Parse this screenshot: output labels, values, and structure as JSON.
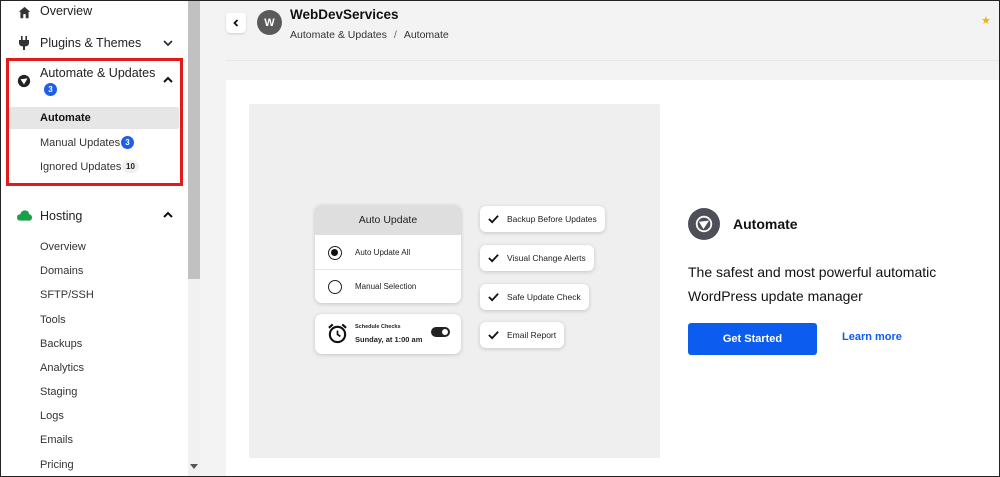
{
  "sidebar": {
    "overview": "Overview",
    "plugins_themes": "Plugins & Themes",
    "automate_updates": "Automate & Updates",
    "automate_badge": "3",
    "sub_items": {
      "automate": "Automate",
      "manual_updates": "Manual Updates",
      "manual_badge": "3",
      "ignored_updates": "Ignored Updates",
      "ignored_badge": "10"
    },
    "hosting": "Hosting",
    "hosting_items": [
      "Overview",
      "Domains",
      "SFTP/SSH",
      "Tools",
      "Backups",
      "Analytics",
      "Staging",
      "Logs",
      "Emails",
      "Pricing"
    ]
  },
  "header": {
    "avatar_letter": "W",
    "site_name": "WebDevServices",
    "breadcrumb": [
      "Automate & Updates",
      "Automate"
    ],
    "separator": "/"
  },
  "illustration": {
    "panel_title": "Auto Update",
    "options": [
      "Auto Update All",
      "Manual Selection"
    ],
    "schedule_label": "Schedule Checks",
    "schedule_value": "Sunday, at 1:00 am",
    "checks": [
      "Backup Before Updates",
      "Visual Change Alerts",
      "Safe Update Check",
      "Email Report"
    ]
  },
  "main": {
    "title": "Automate",
    "description": "The safest and most powerful automatic WordPress update manager",
    "primary_button": "Get Started",
    "secondary_link": "Learn more"
  },
  "colors": {
    "accent": "#0d5cf0",
    "badge_blue": "#1d5fe6",
    "highlight_red": "#e21a1a",
    "hosting_icon": "#1aa04a"
  }
}
